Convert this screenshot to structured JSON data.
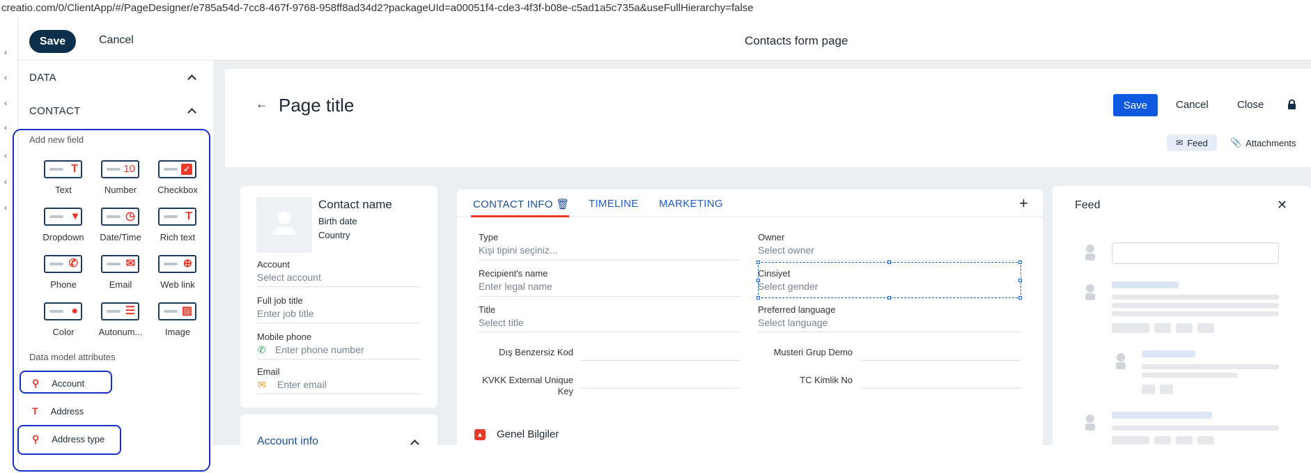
{
  "browser": {
    "url": "creatio.com/0/ClientApp/#/PageDesigner/e785a54d-7cc8-467f-9768-958ff8ad34d2?packageUId=a00051f4-cde3-4f3f-b08e-c5ad1a5c735a&useFullHierarchy=false"
  },
  "designer": {
    "save_label": "Save",
    "cancel_label": "Cancel",
    "title": "Contacts form page"
  },
  "left_panel": {
    "data_section": "DATA",
    "contact_section": "CONTACT",
    "add_new_field": "Add new field",
    "tiles": [
      {
        "label": "Text",
        "glyph": "T",
        "icon": "text-field-icon"
      },
      {
        "label": "Number",
        "glyph": "10",
        "icon": "number-field-icon"
      },
      {
        "label": "Checkbox",
        "glyph": "✓",
        "icon": "checkbox-field-icon"
      },
      {
        "label": "Dropdown",
        "glyph": "▾",
        "icon": "dropdown-field-icon"
      },
      {
        "label": "Date/Time",
        "glyph": "◷",
        "icon": "datetime-field-icon"
      },
      {
        "label": "Rich text",
        "glyph": "T",
        "icon": "richtext-field-icon"
      },
      {
        "label": "Phone",
        "glyph": "✆",
        "icon": "phone-field-icon"
      },
      {
        "label": "Email",
        "glyph": "✉",
        "icon": "email-field-icon"
      },
      {
        "label": "Web link",
        "glyph": "⊕",
        "icon": "weblink-field-icon"
      },
      {
        "label": "Color",
        "glyph": "●",
        "icon": "color-field-icon"
      },
      {
        "label": "Autonum...",
        "glyph": "☰",
        "icon": "autonumber-field-icon"
      },
      {
        "label": "Image",
        "glyph": "▨",
        "icon": "image-field-icon"
      }
    ],
    "data_model_attributes": "Data model attributes",
    "attributes": [
      {
        "label": "Account",
        "icon": "lookup-icon"
      },
      {
        "label": "Address",
        "icon": "text-icon"
      },
      {
        "label": "Address type",
        "icon": "lookup-icon"
      }
    ]
  },
  "page": {
    "title": "Page title",
    "save_label": "Save",
    "cancel_label": "Cancel",
    "close_label": "Close",
    "feed_label": "Feed",
    "attachments_label": "Attachments"
  },
  "profile": {
    "name": "Contact name",
    "birth_date": "Birth date",
    "country": "Country",
    "fields": [
      {
        "label": "Account",
        "value": "Select account"
      },
      {
        "label": "Full job title",
        "value": "Enter job title"
      },
      {
        "label": "Mobile phone",
        "value": "Enter phone number"
      },
      {
        "label": "Email",
        "value": "Enter email"
      }
    ],
    "account_info": "Account info"
  },
  "tabs": {
    "items": [
      "CONTACT INFO",
      "TIMELINE",
      "MARKETING"
    ],
    "active": "CONTACT INFO"
  },
  "contact_info": {
    "fields": [
      {
        "label": "Type",
        "value": "Kişi tipini seçiniz..."
      },
      {
        "label": "Owner",
        "value": "Select owner"
      },
      {
        "label": "Recipient's name",
        "value": "Enter legal name"
      },
      {
        "label": "Cinsiyet",
        "value": "Select gender"
      },
      {
        "label": "Title",
        "value": "Select title"
      },
      {
        "label": "Preferred language",
        "value": "Select language"
      }
    ],
    "inline_fields": [
      {
        "label": "Dış Benzersiz Kod"
      },
      {
        "label": "Musteri Grup Demo"
      },
      {
        "label": "KVKK External Unique Key"
      },
      {
        "label": "TC Kimlik No"
      }
    ],
    "group_title": "Genel Bilgiler"
  },
  "feed": {
    "title": "Feed"
  },
  "colors": {
    "accent": "#e8392b",
    "primary": "#0d5ae0",
    "dark": "#0b2f4a",
    "annotation": "#1530c8"
  }
}
